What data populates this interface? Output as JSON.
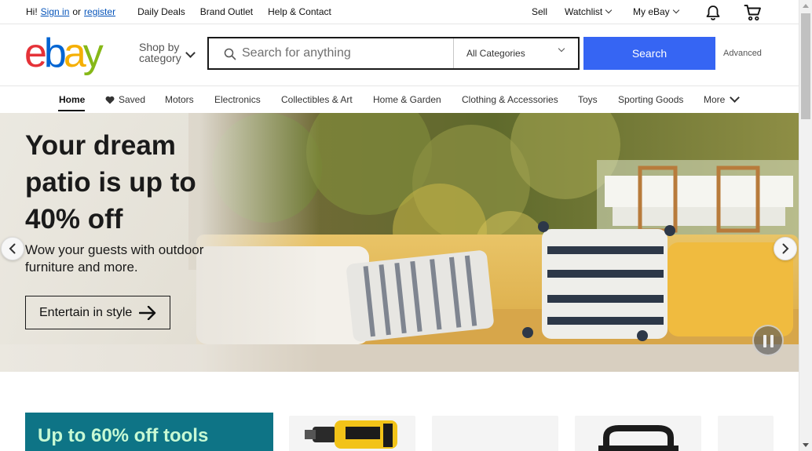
{
  "topbar": {
    "greeting": "Hi!",
    "sign_in": "Sign in",
    "or": "or",
    "register": "register",
    "daily_deals": "Daily Deals",
    "brand_outlet": "Brand Outlet",
    "help_contact": "Help & Contact",
    "sell": "Sell",
    "watchlist": "Watchlist",
    "my_ebay": "My eBay"
  },
  "header": {
    "logo": [
      "e",
      "b",
      "a",
      "y"
    ],
    "shop_by_line1": "Shop by",
    "shop_by_line2": "category",
    "search_placeholder": "Search for anything",
    "category_selected": "All Categories",
    "search_button": "Search",
    "advanced": "Advanced"
  },
  "nav": {
    "items": [
      "Home",
      "Saved",
      "Motors",
      "Electronics",
      "Collectibles & Art",
      "Home & Garden",
      "Clothing & Accessories",
      "Toys",
      "Sporting Goods",
      "More"
    ]
  },
  "hero": {
    "title": "Your dream patio is up to 40% off",
    "subtitle": "Wow your guests with outdoor furniture and more.",
    "cta": "Entertain in style"
  },
  "promo": {
    "title": "Up to 60% off tools"
  },
  "colors": {
    "search_button": "#3665f3",
    "promo_bg": "#0e7486",
    "promo_text": "#c7f9d4",
    "link": "#0654ba"
  },
  "icons": {
    "bell": "bell-icon",
    "cart": "cart-icon",
    "search": "search-icon",
    "heart": "heart-icon"
  }
}
